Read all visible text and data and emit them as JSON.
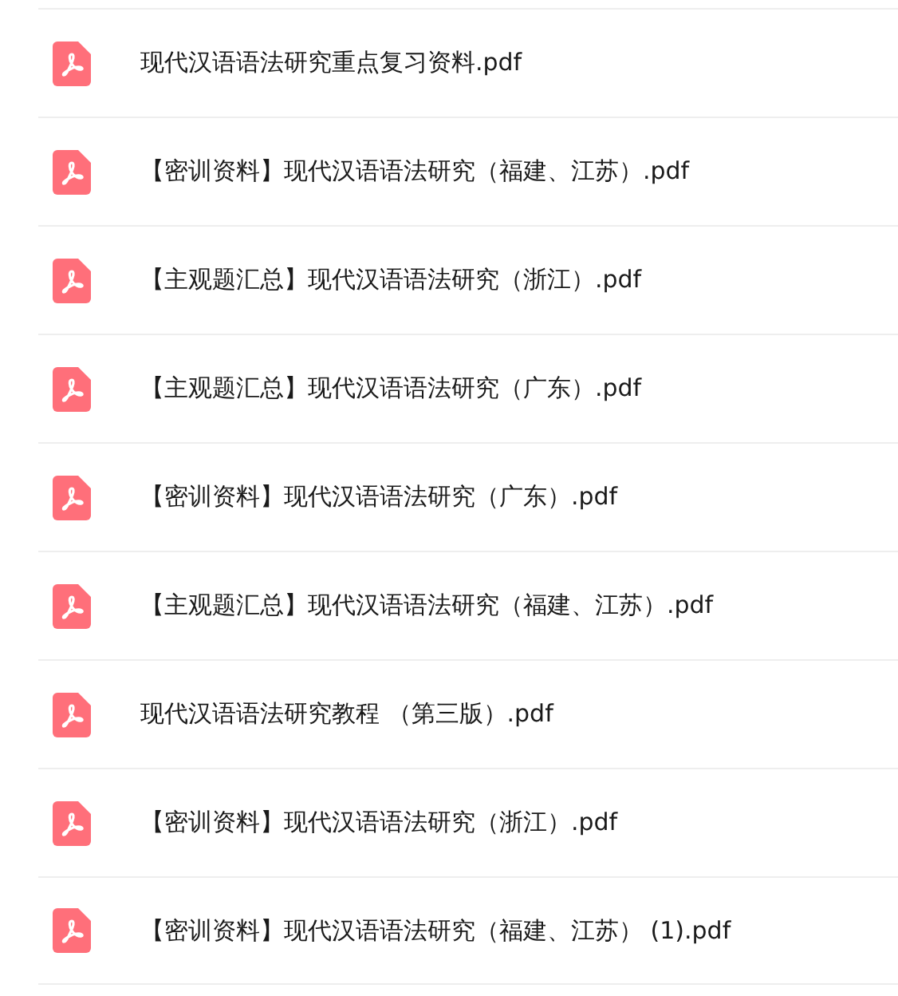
{
  "files": [
    {
      "name": "现代汉语语法研究重点复习资料.pdf",
      "kind": "pdf"
    },
    {
      "name": "【密训资料】现代汉语语法研究（福建、江苏）.pdf",
      "kind": "pdf"
    },
    {
      "name": "【主观题汇总】现代汉语语法研究（浙江）.pdf",
      "kind": "pdf"
    },
    {
      "name": "【主观题汇总】现代汉语语法研究（广东）.pdf",
      "kind": "pdf"
    },
    {
      "name": "【密训资料】现代汉语语法研究（广东）.pdf",
      "kind": "pdf"
    },
    {
      "name": "【主观题汇总】现代汉语语法研究（福建、江苏）.pdf",
      "kind": "pdf"
    },
    {
      "name": "现代汉语语法研究教程 （第三版）.pdf",
      "kind": "pdf"
    },
    {
      "name": "【密训资料】现代汉语语法研究（浙江）.pdf",
      "kind": "pdf"
    },
    {
      "name": "【密训资料】现代汉语语法研究（福建、江苏） (1).pdf",
      "kind": "pdf"
    }
  ]
}
